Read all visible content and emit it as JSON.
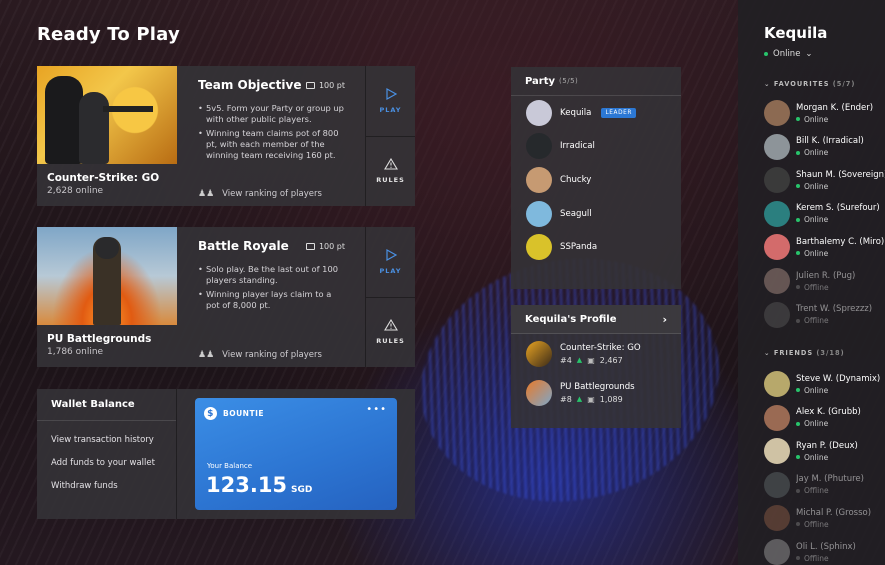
{
  "page_title": "Ready To Play",
  "games": [
    {
      "name": "Counter-Strike: GO",
      "online": "2,628 online",
      "mode": "Team Objective",
      "points": "100 pt",
      "desc": [
        "5v5. Form your Party or group up with other public players.",
        "Winning team claims pot of 800 pt, with each member of the winning team receiving 160 pt."
      ],
      "ranking": "View ranking of players",
      "play": "PLAY",
      "rules": "RULES"
    },
    {
      "name": "PU Battlegrounds",
      "online": "1,786 online",
      "mode": "Battle Royale",
      "points": "100 pt",
      "desc": [
        "Solo play. Be the last out of 100 players standing.",
        "Winning player lays claim to a pot of 8,000 pt."
      ],
      "ranking": "View ranking of players",
      "play": "PLAY",
      "rules": "RULES"
    }
  ],
  "wallet": {
    "title": "Wallet Balance",
    "links": [
      "View transaction history",
      "Add funds to your wallet",
      "Withdraw funds"
    ],
    "card": {
      "brand": "BOUNTIE",
      "menu": "•••",
      "balance_label": "Your Balance",
      "amount": "123.15",
      "currency": "SGD",
      "color": "#2c74d1"
    }
  },
  "party": {
    "title": "Party",
    "count": "(5/5)",
    "leader_badge": "LEADER",
    "members": [
      {
        "name": "Kequila",
        "avatar_color": "#c9c9d8"
      },
      {
        "name": "Irradical",
        "avatar_color": "#26292c"
      },
      {
        "name": "Chucky",
        "avatar_color": "#c69a72"
      },
      {
        "name": "Seagull",
        "avatar_color": "#7fb9dd"
      },
      {
        "name": "SSPanda",
        "avatar_color": "#d9c22a"
      }
    ]
  },
  "profile": {
    "title": "Kequila's Profile",
    "games": [
      {
        "name": "Counter-Strike: GO",
        "rank": "#4",
        "score": "2,467"
      },
      {
        "name": "PU Battlegrounds",
        "rank": "#8",
        "score": "1,089"
      }
    ]
  },
  "user": {
    "name": "Kequila",
    "status": "Online"
  },
  "favourites": {
    "title": "FAVOURITES",
    "count": "(5/7)",
    "items": [
      {
        "name": "Morgan K. (Ender)",
        "status": "Online",
        "online": true,
        "avatar_color": "#8c6a52"
      },
      {
        "name": "Bill K. (Irradical)",
        "status": "Online",
        "online": true,
        "avatar_color": "#8d9499"
      },
      {
        "name": "Shaun M. (Sovereign)",
        "status": "Online",
        "online": true,
        "avatar_color": "#3a3a3a"
      },
      {
        "name": "Kerem S. (Surefour)",
        "status": "Online",
        "online": true,
        "avatar_color": "#2b7f7f"
      },
      {
        "name": "Barthalemy C. (Miro)",
        "status": "Online",
        "online": true,
        "avatar_color": "#d36b6b"
      },
      {
        "name": "Julien R. (Pug)",
        "status": "Offline",
        "online": false,
        "avatar_color": "#a88d83"
      },
      {
        "name": "Trent W. (Sprezzz)",
        "status": "Offline",
        "online": false,
        "avatar_color": "#555"
      }
    ]
  },
  "friends": {
    "title": "FRIENDS",
    "count": "(3/18)",
    "items": [
      {
        "name": "Steve W. (Dynamix)",
        "status": "Online",
        "online": true,
        "avatar_color": "#b7a86b"
      },
      {
        "name": "Alex K. (Grubb)",
        "status": "Online",
        "online": true,
        "avatar_color": "#9a6a53"
      },
      {
        "name": "Ryan P. (Deux)",
        "status": "Online",
        "online": true,
        "avatar_color": "#cfc2a4"
      },
      {
        "name": "Jay M. (Phuture)",
        "status": "Offline",
        "online": false,
        "avatar_color": "#5d6668"
      },
      {
        "name": "Michal P. (Grosso)",
        "status": "Offline",
        "online": false,
        "avatar_color": "#8a5a44"
      },
      {
        "name": "Oli L. (Sphinx)",
        "status": "Offline",
        "online": false,
        "avatar_color": "#999"
      }
    ]
  }
}
